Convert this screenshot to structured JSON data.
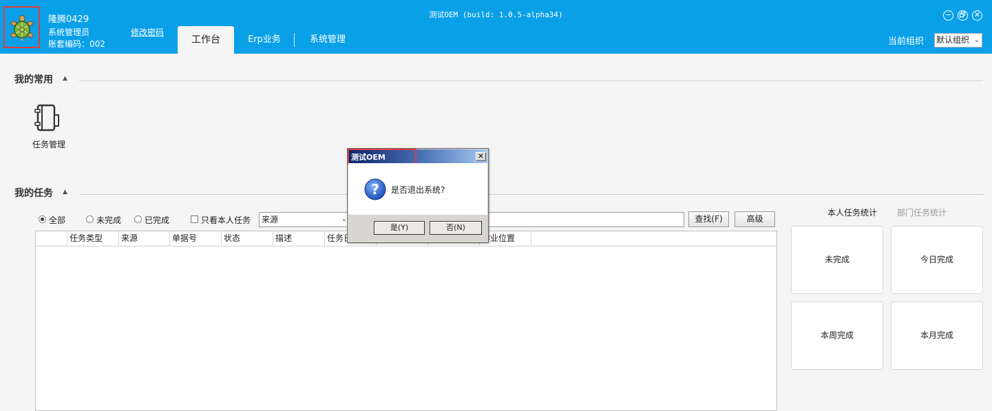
{
  "header": {
    "user_name": "隆腾0429",
    "user_role": "系统管理员",
    "account_code": "账套编码：002",
    "change_password": "修改密码",
    "window_title": "测试OEM (build: 1.0.5-alpha34)",
    "tabs": [
      {
        "label": "工作台",
        "active": true
      },
      {
        "label": "Erp业务",
        "active": false
      },
      {
        "label": "系统管理",
        "active": false
      }
    ],
    "org_label": "当前组织",
    "org_value": "默认组织",
    "brand_color": "#0aa0e8"
  },
  "frequent": {
    "title": "我的常用",
    "items": [
      {
        "label": "任务管理",
        "icon": "notebook-icon"
      }
    ]
  },
  "tasks": {
    "title": "我的任务",
    "radios": [
      {
        "label": "全部",
        "selected": true
      },
      {
        "label": "未完成",
        "selected": false
      },
      {
        "label": "已完成",
        "selected": false
      }
    ],
    "only_mine_label": "只看本人任务",
    "only_mine_checked": false,
    "source_value": "来源",
    "search_value": "",
    "find_button": "查找(F)",
    "advanced_button": "高级",
    "columns": [
      "",
      "任务类型",
      "来源",
      "单据号",
      "状态",
      "描述",
      "任务日",
      "",
      "",
      "作业位置"
    ],
    "rows": []
  },
  "stats": {
    "tab_mine": "本人任务统计",
    "tab_dept": "部门任务统计",
    "cards": [
      "未完成",
      "今日完成",
      "本周完成",
      "本月完成"
    ]
  },
  "dialog": {
    "title": "测试OEM",
    "message": "是否退出系统?",
    "yes_button": "是(Y)",
    "no_button": "否(N)",
    "icon": "question-icon"
  }
}
